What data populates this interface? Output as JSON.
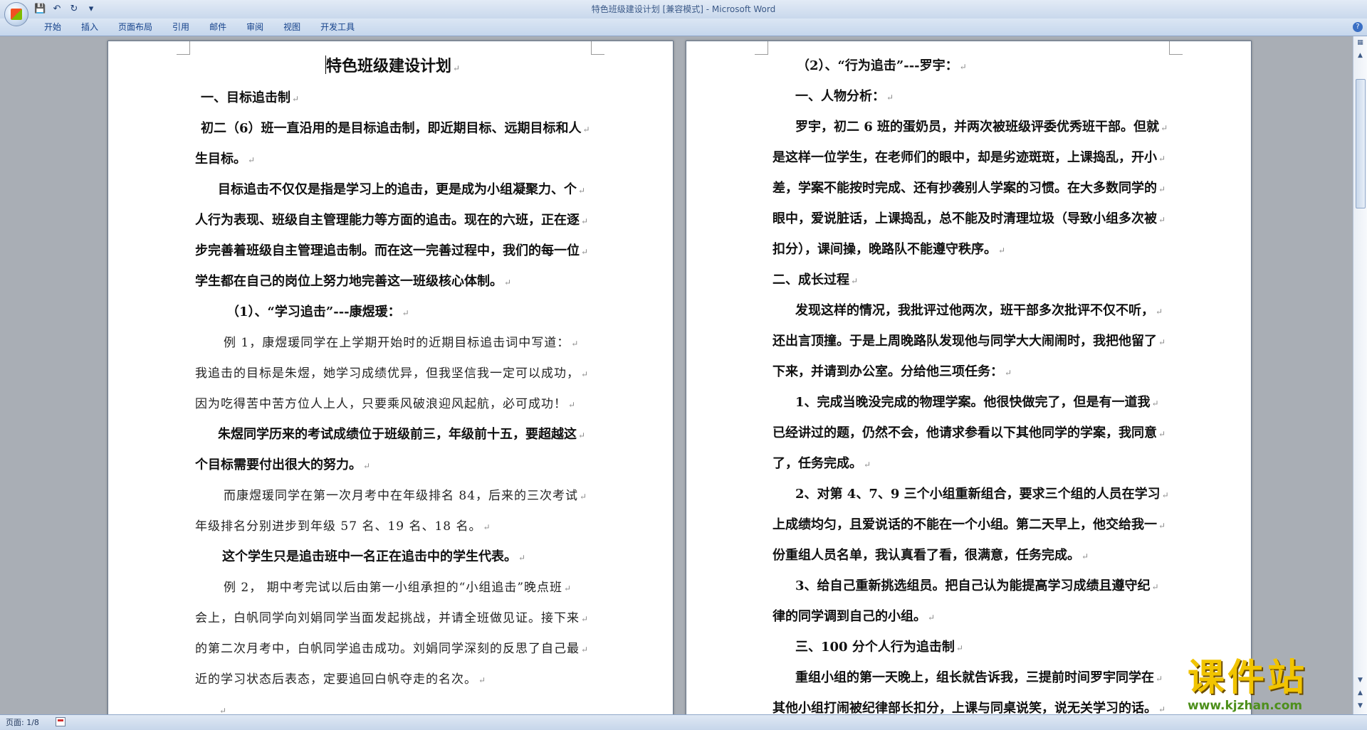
{
  "window": {
    "title": "特色班级建设计划 [兼容模式] - Microsoft Word"
  },
  "quick_access": [
    "save-icon",
    "undo-icon",
    "redo-icon",
    "customize-icon"
  ],
  "ribbon": {
    "tabs": [
      "开始",
      "插入",
      "页面布局",
      "引用",
      "邮件",
      "审阅",
      "视图",
      "开发工具"
    ]
  },
  "pages": {
    "left": {
      "paragraphs": [
        {
          "text": "特色班级建设计划",
          "style": "title"
        },
        {
          "text": "一、目标追击制",
          "style": "bold"
        },
        {
          "text": "初二（6）班一直沿用的是目标追击制，即近期目标、远期目标和人",
          "style": "bold"
        },
        {
          "text": "生目标。",
          "style": "bold"
        },
        {
          "text": "目标追击不仅仅是指是学习上的追击，更是成为小组凝聚力、个",
          "style": "bold"
        },
        {
          "text": "人行为表现、班级自主管理能力等方面的追击。现在的六班，正在逐",
          "style": "bold"
        },
        {
          "text": "步完善着班级自主管理追击制。而在这一完善过程中，我们的每一位",
          "style": "bold"
        },
        {
          "text": "学生都在自己的岗位上努力地完善这一班级核心体制。",
          "style": "bold"
        },
        {
          "text": "（1）、“学习追击”---康煜瑗：",
          "style": "bold"
        },
        {
          "text": "例 1，康煜瑗同学在上学期开始时的近期目标追击词中写道：",
          "style": "light"
        },
        {
          "text": "我追击的目标是朱煜，她学习成绩优异，但我坚信我一定可以成功，",
          "style": "light"
        },
        {
          "text": "因为吃得苦中苦方位人上人，只要乘风破浪迎风起航，必可成功！",
          "style": "light"
        },
        {
          "text": "朱煜同学历来的考试成绩位于班级前三，年级前十五，要超越这",
          "style": "bold"
        },
        {
          "text": "个目标需要付出很大的努力。",
          "style": "bold"
        },
        {
          "text": "而康煜瑗同学在第一次月考中在年级排名 84，后来的三次考试",
          "style": "light"
        },
        {
          "text": "年级排名分别进步到年级 57 名、19 名、18 名。",
          "style": "light"
        },
        {
          "text": "这个学生只是追击班中一名正在追击中的学生代表。",
          "style": "bold"
        },
        {
          "text": "例 2， 期中考完试以后由第一小组承担的“小组追击”晚点班",
          "style": "light"
        },
        {
          "text": "会上，白帆同学向刘娟同学当面发起挑战，并请全班做见证。接下来",
          "style": "light"
        },
        {
          "text": "的第二次月考中，白帆同学追击成功。刘娟同学深刻的反思了自己最",
          "style": "light"
        },
        {
          "text": "近的学习状态后表态，定要追回白帆夺走的名次。",
          "style": "light"
        },
        {
          "text": "",
          "style": "light"
        }
      ]
    },
    "right": {
      "paragraphs": [
        {
          "text": "（2）、“行为追击”---罗宇：",
          "style": "bold"
        },
        {
          "text": "一、人物分析：",
          "style": "bold"
        },
        {
          "text": "罗宇，初二 6 班的蛋奶员，并两次被班级评委优秀班干部。但就",
          "style": "bold"
        },
        {
          "text": "是这样一位学生，在老师们的眼中，却是劣迹斑斑，上课捣乱，开小",
          "style": "bold"
        },
        {
          "text": "差，学案不能按时完成、还有抄袭别人学案的习惯。在大多数同学的",
          "style": "bold"
        },
        {
          "text": "眼中，爱说脏话，上课捣乱，总不能及时清理垃圾（导致小组多次被",
          "style": "bold"
        },
        {
          "text": "扣分），课间操，晚路队不能遵守秩序。",
          "style": "bold"
        },
        {
          "text": "二、成长过程",
          "style": "bold"
        },
        {
          "text": "发现这样的情况，我批评过他两次，班干部多次批评不仅不听，",
          "style": "bold"
        },
        {
          "text": "还出言顶撞。于是上周晚路队发现他与同学大大闹闹时，我把他留了",
          "style": "bold"
        },
        {
          "text": "下来，并请到办公室。分给他三项任务：",
          "style": "bold"
        },
        {
          "text": "1、完成当晚没完成的物理学案。他很快做完了，但是有一道我",
          "style": "bold"
        },
        {
          "text": "已经讲过的题，仍然不会，他请求参看以下其他同学的学案，我同意",
          "style": "bold"
        },
        {
          "text": "了，任务完成。",
          "style": "bold"
        },
        {
          "text": "2、对第 4、7、9 三个小组重新组合，要求三个组的人员在学习",
          "style": "bold"
        },
        {
          "text": "上成绩均匀，且爱说话的不能在一个小组。第二天早上，他交给我一",
          "style": "bold"
        },
        {
          "text": "份重组人员名单，我认真看了看，很满意，任务完成。",
          "style": "bold"
        },
        {
          "text": "3、给自己重新挑选组员。把自己认为能提高学习成绩且遵守纪",
          "style": "bold"
        },
        {
          "text": "律的同学调到自己的小组。",
          "style": "bold"
        },
        {
          "text": "三、100 分个人行为追击制",
          "style": "bold"
        },
        {
          "text": "重组小组的第一天晚上，组长就告诉我，三提前时间罗宇同学在",
          "style": "bold"
        },
        {
          "text": "其他小组打闹被纪律部长扣分，上课与同桌说笑，说无关学习的话。",
          "style": "bold"
        }
      ]
    }
  },
  "status": {
    "page": "页面: 1/8"
  },
  "watermark": {
    "text": "课件站",
    "url": "www.kjzhan.com"
  },
  "colors": {
    "ribbon_text": "#15428b",
    "workspace": "#a9aeb5",
    "watermark": "#f1c400",
    "watermark_url": "#4d8f1b"
  }
}
